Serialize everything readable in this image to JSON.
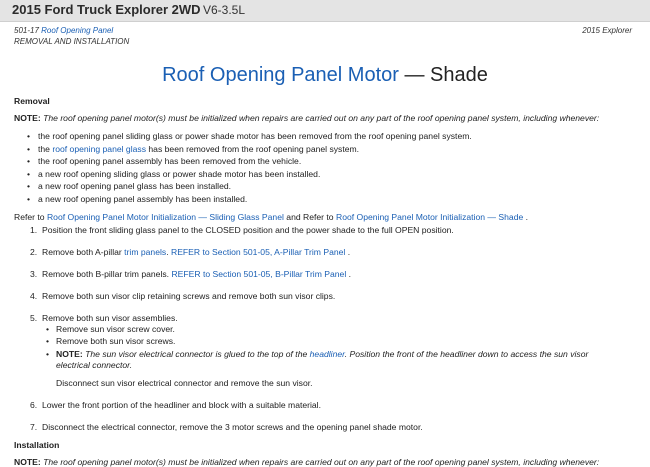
{
  "header": {
    "title": "2015 Ford Truck Explorer 2WD",
    "engine": "V6-3.5L"
  },
  "meta": {
    "section_num": "501-17",
    "section_link": "Roof Opening Panel",
    "procedure": "REMOVAL AND INSTALLATION",
    "vehicle": "2015 Explorer"
  },
  "page": {
    "title_link": "Roof Opening Panel Motor",
    "title_suffix": "— Shade"
  },
  "removal": {
    "heading": "Removal",
    "note_label": "NOTE:",
    "note_text": "The roof opening panel motor(s) must be initialized when repairs are carried out on any part of the roof opening panel system, including whenever:",
    "bullets": {
      "b0": "the roof opening panel sliding glass or power shade motor has been removed from the roof opening panel system.",
      "b1_pre": "the ",
      "b1_link": "roof opening panel glass",
      "b1_post": " has been removed from the roof opening panel system.",
      "b2": "the roof opening panel assembly has been removed from the vehicle.",
      "b3": "a new roof opening sliding glass or power shade motor has been installed.",
      "b4": "a new roof opening panel glass has been installed.",
      "b5": "a new roof opening panel assembly has been installed."
    },
    "refer_pre": "Refer to ",
    "refer_link1": "Roof Opening Panel Motor Initialization — Sliding Glass Panel",
    "refer_mid": " and Refer to ",
    "refer_link2": "Roof Opening Panel Motor Initialization — Shade",
    "refer_post": " .",
    "steps": {
      "s1_num": "1.",
      "s1": "Position the front sliding glass panel to the CLOSED position and the power shade to the full OPEN position.",
      "s2_num": "2.",
      "s2_pre": "Remove both A-pillar ",
      "s2_link1": "trim panels",
      "s2_mid": ". ",
      "s2_link2": "REFER to Section 501-05, A-Pillar Trim Panel",
      "s2_post": " .",
      "s3_num": "3.",
      "s3_pre": "Remove both B-pillar trim panels. ",
      "s3_link": "REFER to Section 501-05, B-Pillar Trim Panel",
      "s3_post": " .",
      "s4_num": "4.",
      "s4": "Remove both sun visor clip retaining screws and remove both sun visor clips.",
      "s5_num": "5.",
      "s5": "Remove both sun visor assemblies.",
      "s5_sub1": "Remove sun visor screw cover.",
      "s5_sub2": "Remove both sun visor screws.",
      "s5_note_label": "NOTE:",
      "s5_note_pre": "The sun visor electrical connector is glued to the top of the ",
      "s5_note_link": "headliner",
      "s5_note_post": ". Position the front of the headliner down to access the sun visor electrical connector.",
      "s5_after": "Disconnect sun visor electrical connector and remove the sun visor.",
      "s6_num": "6.",
      "s6": "Lower the front portion of the headliner and block with a suitable material.",
      "s7_num": "7.",
      "s7": "Disconnect the electrical connector, remove the 3 motor screws and the opening panel shade motor."
    }
  },
  "installation": {
    "heading": "Installation",
    "note_label": "NOTE:",
    "note_text": "The roof opening panel motor(s) must be initialized when repairs are carried out on any part of the roof opening panel system, including whenever:"
  }
}
